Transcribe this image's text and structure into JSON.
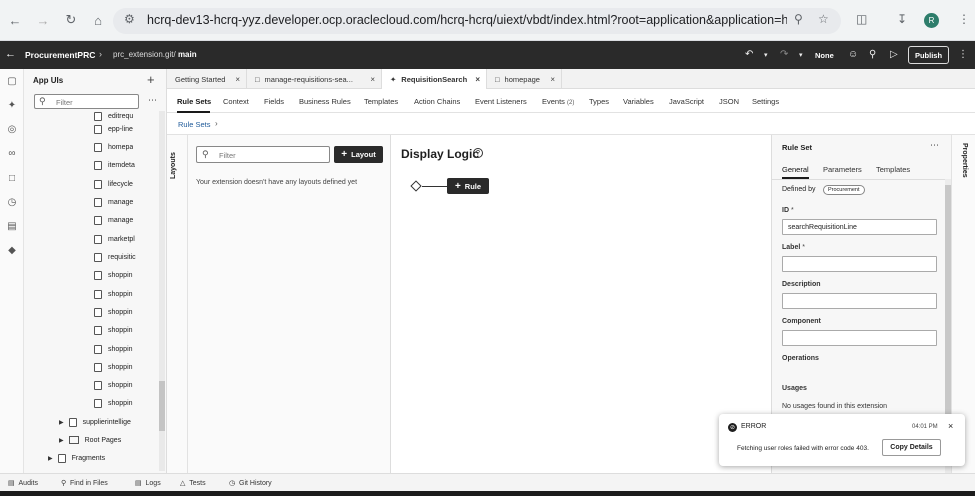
{
  "browser": {
    "url": "hcrq-dev13-hcrq-yyz.developer.ocp.oraclecloud.com/hcrq-hcrq/uiext/vbdt/index.html?root=application&application=hcrq-hcrq_exte...",
    "avatar_letter": "R"
  },
  "header": {
    "app_title": "ProcurementPRC",
    "repo": "prc_extension.git/",
    "branch": "main",
    "none_label": "None",
    "publish_label": "Publish"
  },
  "apps_panel": {
    "title": "App UIs",
    "filter_placeholder": "Filter",
    "items": [
      {
        "label": "editrequ",
        "type": "file"
      },
      {
        "label": "epp-line",
        "type": "file"
      },
      {
        "label": "homepa",
        "type": "file"
      },
      {
        "label": "itemdeta",
        "type": "file"
      },
      {
        "label": "lifecycle",
        "type": "file"
      },
      {
        "label": "manage",
        "type": "file"
      },
      {
        "label": "manage",
        "type": "file"
      },
      {
        "label": "marketpl",
        "type": "file"
      },
      {
        "label": "requisitic",
        "type": "file"
      },
      {
        "label": "shoppin",
        "type": "file"
      },
      {
        "label": "shoppin",
        "type": "file"
      },
      {
        "label": "shoppin",
        "type": "file"
      },
      {
        "label": "shoppin",
        "type": "file"
      },
      {
        "label": "shoppin",
        "type": "file"
      },
      {
        "label": "shoppin",
        "type": "file"
      },
      {
        "label": "shoppin",
        "type": "file"
      },
      {
        "label": "shoppin",
        "type": "file"
      }
    ],
    "tree_tail": [
      {
        "label": "supplierintellige",
        "type": "file-group"
      },
      {
        "label": "Root Pages",
        "type": "folder"
      },
      {
        "label": "Fragments",
        "type": "fragment"
      }
    ]
  },
  "doc_tabs": [
    {
      "label": "Getting Started",
      "active": false
    },
    {
      "label": "manage-requisitions-sea...",
      "active": false
    },
    {
      "label": "RequisitionSearch",
      "active": true
    },
    {
      "label": "homepage",
      "active": false
    }
  ],
  "subnav": [
    "Rule Sets",
    "Context",
    "Fields",
    "Business Rules",
    "Templates",
    "Action Chains",
    "Event Listeners",
    "Events",
    "Types",
    "Variables",
    "JavaScript",
    "JSON",
    "Settings"
  ],
  "events_count": "(2)",
  "breadcrumb": {
    "link": "Rule Sets"
  },
  "layouts": {
    "rail_label": "Layouts",
    "filter_placeholder": "Filter",
    "layout_button": "Layout",
    "empty_text": "Your extension doesn't have any layouts defined yet"
  },
  "canvas": {
    "title": "Display Logic",
    "rule_button": "Rule"
  },
  "properties": {
    "rail_label": "Properties",
    "title": "Rule Set",
    "tabs": [
      "General",
      "Parameters",
      "Templates"
    ],
    "defined_by_label": "Defined by",
    "defined_by_value": "Procurement",
    "id_label": "ID",
    "id_value": "searchRequisitionLine",
    "label_label": "Label",
    "label_value": "",
    "description_label": "Description",
    "description_value": "",
    "component_label": "Component",
    "component_value": "",
    "operations_label": "Operations",
    "usages_label": "Usages",
    "usages_text": "No usages found in this extension"
  },
  "toast": {
    "title": "ERROR",
    "time": "04:01 PM",
    "message": "Fetching user roles failed with error code 403.",
    "copy_button": "Copy Details"
  },
  "bottom_bar": [
    "Audits",
    "Find in Files",
    "Logs",
    "Tests",
    "Git History"
  ],
  "colors": {
    "header_bg": "#2a2a2a",
    "link": "#1f5a99",
    "avatar": "#2e7d6b"
  }
}
